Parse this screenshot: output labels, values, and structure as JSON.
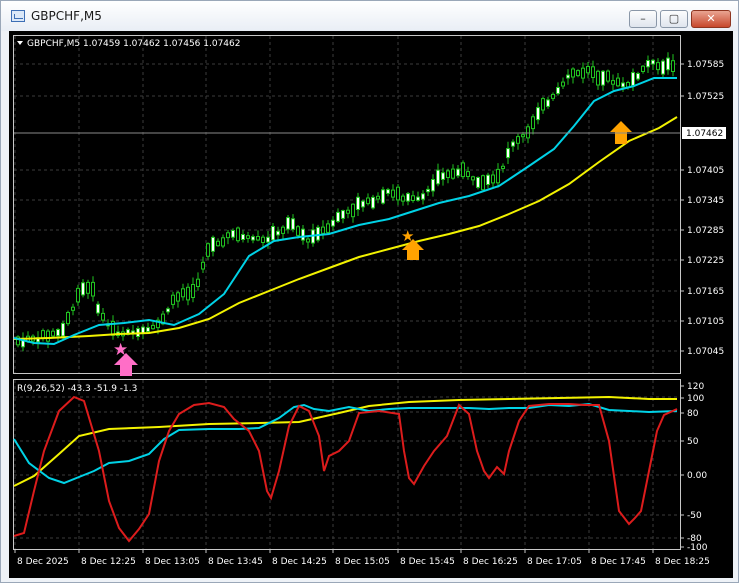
{
  "window": {
    "title": "GBPCHF,M5",
    "minimize_glyph": "–",
    "maximize_glyph": "▢",
    "close_glyph": "✕"
  },
  "price_panel": {
    "header": "GBPCHF,M5  1.07459 1.07462 1.07456 1.07462",
    "current_price": "1.07462",
    "y_ticks": [
      "1.07585",
      "1.07525",
      "1.07405",
      "1.07345",
      "1.07285",
      "1.07225",
      "1.07165",
      "1.07105",
      "1.07045"
    ]
  },
  "indicator_panel": {
    "header": "R(9,26,52) -43.3 -51.9 -1.3",
    "y_ticks": [
      "120",
      "100",
      "80",
      "50",
      "0.00",
      "-50",
      "-80",
      "-100"
    ]
  },
  "time_axis": [
    "8 Dec 2025",
    "8 Dec 12:25",
    "8 Dec 13:05",
    "8 Dec 13:45",
    "8 Dec 14:25",
    "8 Dec 15:05",
    "8 Dec 15:45",
    "8 Dec 16:25",
    "8 Dec 17:05",
    "8 Dec 17:45",
    "8 Dec 18:25"
  ],
  "colors": {
    "background": "#000000",
    "grid": "#3c3c3c",
    "candle": "#21c321",
    "ma_fast": "#00d2e6",
    "ma_slow": "#f2f200",
    "osc_line": "#dc1c1c",
    "signal_pink": "#ff6ec7",
    "signal_orange": "#ffa200",
    "axis_text": "#ffffff"
  },
  "signals": [
    {
      "type": "buy",
      "color": "pink",
      "label": "buy-arrow-pink"
    },
    {
      "type": "buy",
      "color": "orange",
      "label": "buy-arrow-orange"
    },
    {
      "type": "buy",
      "color": "orange",
      "label": "buy-arrow-orange"
    }
  ]
}
